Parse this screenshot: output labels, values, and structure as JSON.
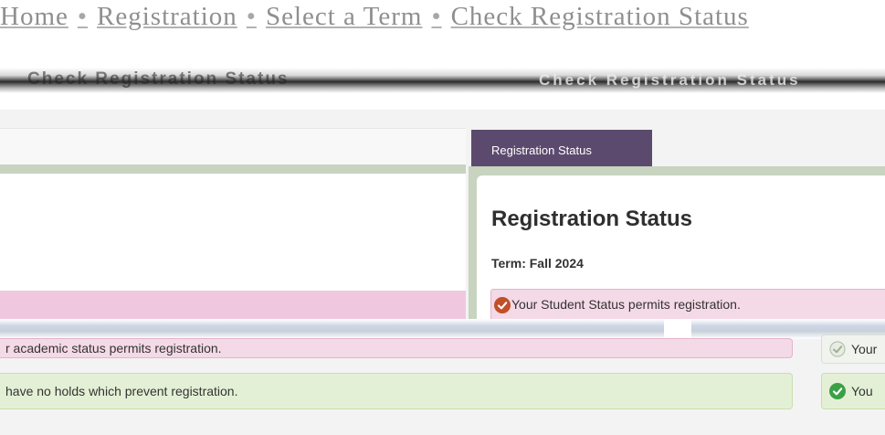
{
  "breadcrumb": {
    "home": "Home",
    "registration": "Registration",
    "select_term": "Select a Term",
    "check_status": "Check Registration Status",
    "separator": "•"
  },
  "header": {
    "title": "Check Registration Status",
    "title_echo": "Check Registration Status"
  },
  "tab": {
    "label": "Registration Status"
  },
  "status_panel": {
    "heading": "Registration Status",
    "term": "Term: Fall 2024",
    "student_status_msg": "Your Student Status permits registration."
  },
  "messages": {
    "academic_status": "r academic status permits registration.",
    "holds": "have no holds which prevent registration.",
    "mini_academic": "Your",
    "mini_holds": "You"
  },
  "colors": {
    "tab_bg": "#5c4a6e",
    "success_green": "#3aa046",
    "status_orange": "#c0502a",
    "pink_msg": "#f4d9e6",
    "green_msg": "#e4f0d5"
  },
  "icons": {
    "student_status": "check-circle-icon",
    "academic": "check-circle-icon",
    "holds": "check-circle-icon"
  }
}
